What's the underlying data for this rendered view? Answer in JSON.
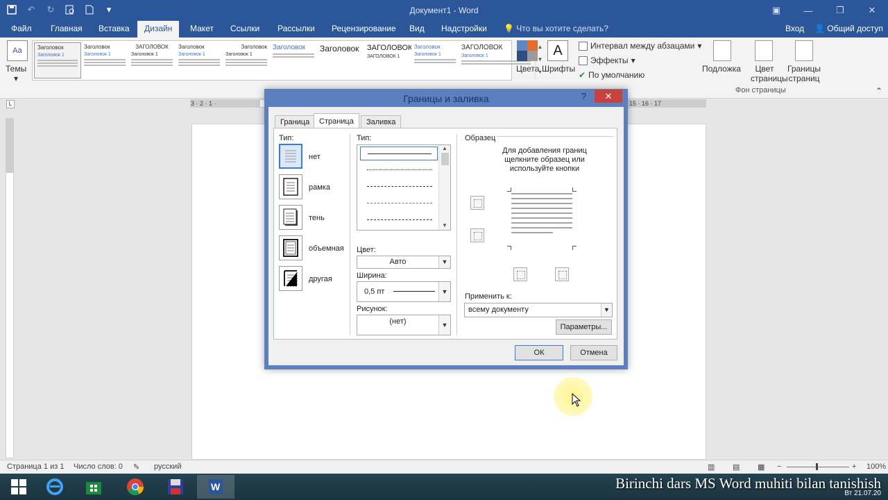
{
  "window": {
    "title": "Документ1 - Word",
    "qat_icons": [
      "save-icon",
      "undo-icon",
      "redo-icon",
      "print-preview-icon",
      "new-doc-icon",
      "customize-qat-icon"
    ]
  },
  "ribbon_tabs": [
    "Файл",
    "Главная",
    "Вставка",
    "Дизайн",
    "Макет",
    "Ссылки",
    "Рассылки",
    "Рецензирование",
    "Вид",
    "Надстройки"
  ],
  "active_tab": "Дизайн",
  "tell_me": "Что вы хотите сделать?",
  "signin": "Вход",
  "share": "Общий доступ",
  "ribbon": {
    "themes": "Темы",
    "gallery": [
      {
        "heading": "Заголовок",
        "sub": "Заголовок 1"
      },
      {
        "heading": "Заголовок",
        "sub": "Заголовок 1"
      },
      {
        "heading": "ЗАГОЛОВОК",
        "sub": "Заголовок 1"
      },
      {
        "heading": "Заголовок",
        "sub": "Заголовок 1"
      },
      {
        "heading": "Заголовок",
        "sub": "Заголовок 1"
      },
      {
        "heading": "Заголовок",
        "sub": ""
      },
      {
        "heading": "Заголовок",
        "sub": ""
      },
      {
        "heading": "ЗАГОЛОВОК",
        "sub": "ЗАГОЛОВОК 1"
      },
      {
        "heading": "Заголовок",
        "sub": "Заголовок 1"
      },
      {
        "heading": "ЗАГОЛОВОК",
        "sub": "Заголовок 1"
      }
    ],
    "colors": "Цвета",
    "fonts": "Шрифты",
    "spacing": "Интервал между абзацами",
    "effects": "Эффекты",
    "default": "По умолчанию",
    "watermark": "Подложка",
    "page_color": "Цвет страницы",
    "page_borders": "Границы страниц",
    "group_label": "Фон страницы"
  },
  "ruler_left": "3 · 2 · 1 ·",
  "ruler_right": "15 · 16 · 17",
  "dialog": {
    "title": "Границы и заливка",
    "help": "?",
    "tabs": [
      "Граница",
      "Страница",
      "Заливка"
    ],
    "active_tab": "Страница",
    "setting_label": "Тип:",
    "settings": [
      "нет",
      "рамка",
      "тень",
      "объемная",
      "другая"
    ],
    "style_label": "Тип:",
    "color_label": "Цвет:",
    "color_value": "Авто",
    "width_label": "Ширина:",
    "width_value": "0,5 пт",
    "art_label": "Рисунок:",
    "art_value": "(нет)",
    "preview_label": "Образец",
    "preview_hint": "Для добавления границ щелкните образец или используйте кнопки",
    "apply_label": "Применить к:",
    "apply_value": "всему документу",
    "options_btn": "Параметры...",
    "ok_btn": "ОК",
    "cancel_btn": "Отмена"
  },
  "status": {
    "page": "Страница 1 из 1",
    "words": "Число слов: 0",
    "language": "русский",
    "zoom": "100%"
  },
  "taskbar": {
    "watermark_text": "Birinchi dars MS Word muhiti bilan tanishish",
    "clock": "Вт 21.07.20"
  },
  "colors": {
    "word_blue": "#2b579a",
    "dialog_border": "#5b7fbf",
    "close_red": "#c8423d"
  }
}
